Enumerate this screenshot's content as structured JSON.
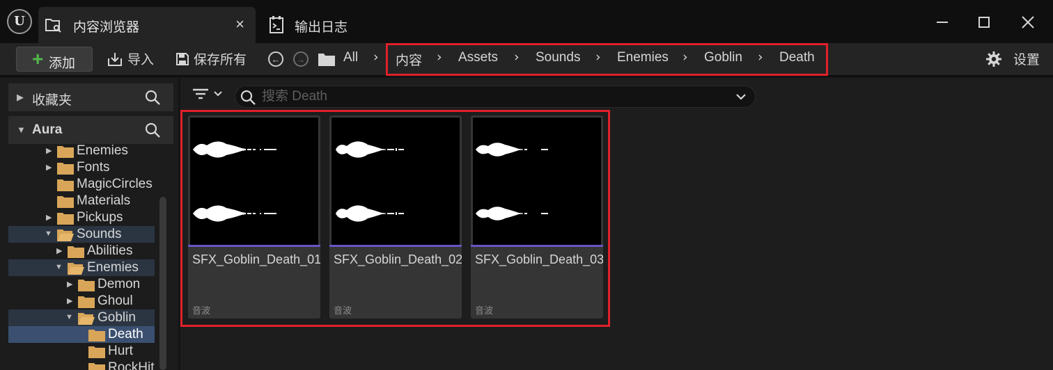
{
  "window": {
    "logo_text": "U",
    "tabs": [
      {
        "label": "内容浏览器",
        "icon": "content-browser-icon",
        "active": true,
        "close": "×"
      },
      {
        "label": "输出日志",
        "icon": "output-log-icon",
        "active": false
      }
    ]
  },
  "toolbar": {
    "add_label": "添加",
    "import_label": "导入",
    "save_all_label": "保存所有",
    "all_label": "All",
    "breadcrumb": [
      "内容",
      "Assets",
      "Sounds",
      "Enemies",
      "Goblin",
      "Death"
    ],
    "settings_label": "设置"
  },
  "sidebar": {
    "favorites_label": "收藏夹",
    "root_label": "Aura",
    "tree": [
      {
        "label": "Enemies",
        "expander": "right"
      },
      {
        "label": "Fonts",
        "expander": "right"
      },
      {
        "label": "MagicCircles",
        "expander": "none"
      },
      {
        "label": "Materials",
        "expander": "none"
      },
      {
        "label": "Pickups",
        "expander": "right"
      },
      {
        "label": "Sounds",
        "expander": "down",
        "open": true
      },
      {
        "label": "Abilities",
        "expander": "right"
      },
      {
        "label": "Enemies",
        "expander": "down",
        "open": true
      },
      {
        "label": "Demon",
        "expander": "right"
      },
      {
        "label": "Ghoul",
        "expander": "right"
      },
      {
        "label": "Goblin",
        "expander": "down",
        "open": true
      },
      {
        "label": "Death",
        "expander": "none",
        "selected": true
      },
      {
        "label": "Hurt",
        "expander": "none"
      },
      {
        "label": "RockHit",
        "expander": "none"
      }
    ]
  },
  "content": {
    "search_placeholder": "搜索 Death",
    "assets": [
      {
        "name": "SFX_Goblin_Death_01",
        "type": "音波"
      },
      {
        "name": "SFX_Goblin_Death_02",
        "type": "音波"
      },
      {
        "name": "SFX_Goblin_Death_03",
        "type": "音波"
      }
    ]
  },
  "colors": {
    "highlight_box": "#e0202a",
    "sound_wave_type_bar": "#6a53c8",
    "add_plus": "#53b84a",
    "folder": "#d9a659"
  }
}
